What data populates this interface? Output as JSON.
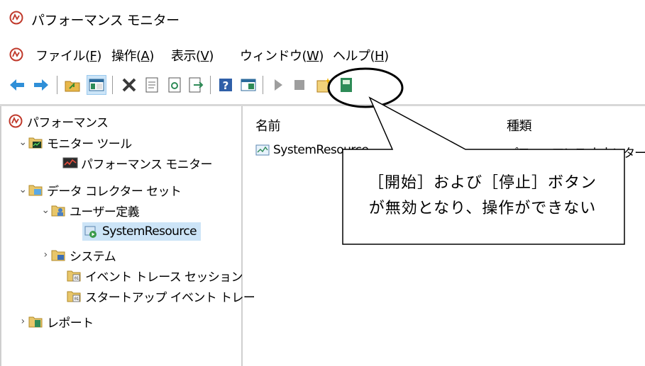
{
  "window": {
    "title": "パフォーマンス モニター"
  },
  "menu": [
    {
      "label": "ファイル(",
      "key": "F",
      "close": ")"
    },
    {
      "label": "操作(",
      "key": "A",
      "close": ")"
    },
    {
      "label": "表示(",
      "key": "V",
      "close": ")"
    },
    {
      "label": "ウィンドウ(",
      "key": "W",
      "close": ")"
    },
    {
      "label": "ヘルプ(",
      "key": "H",
      "close": ")"
    }
  ],
  "tree": {
    "root": "パフォーマンス",
    "monitor_tools": "モニター ツール",
    "perf_monitor": "パフォーマンス モニター",
    "collector_sets": "データ コレクター セット",
    "user_defined": "ユーザー定義",
    "system_resource": "SystemResource",
    "system": "システム",
    "event_trace": "イベント トレース セッション",
    "startup_trace": "スタートアップ イベント トレー",
    "reports": "レポート"
  },
  "list": {
    "col_name": "名前",
    "col_type": "種類",
    "row_name": "SystemResource",
    "row_type": "パフォーマンス カウンター"
  },
  "callout": {
    "line1": "［開始］および［停止］ボタン",
    "line2": "が無効となり、操作ができない"
  },
  "colors": {
    "selection": "#cce4f7",
    "callout_border": "#000000"
  }
}
